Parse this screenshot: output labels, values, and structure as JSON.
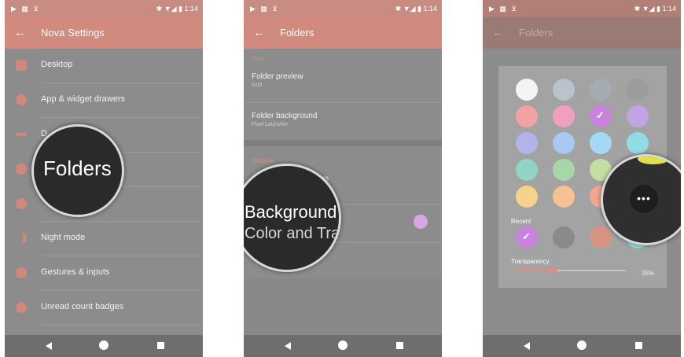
{
  "status": {
    "left_icons": "▶ ▦ ⊻",
    "right_text": "✱ ▼◢ ▮ 1:14"
  },
  "nav_icons": [
    "back-triangle",
    "home-circle",
    "recents-square"
  ],
  "screen1": {
    "title": "Nova Settings",
    "items": [
      {
        "label": "Desktop"
      },
      {
        "label": "App & widget drawers"
      },
      {
        "label": "D"
      },
      {
        "label": ""
      },
      {
        "label": ""
      },
      {
        "label": "Night mode"
      },
      {
        "label": "Gestures & inputs"
      },
      {
        "label": "Unread count badges"
      }
    ],
    "magnifier_text": "Folders"
  },
  "screen2": {
    "title": "Folders",
    "section_icon": "Icon",
    "folder_preview": {
      "title": "Folder preview",
      "value": "Grid"
    },
    "folder_background": {
      "title": "Folder background",
      "value": "Pixel Launcher"
    },
    "section_window": "Window",
    "partial_text": "on",
    "magnifier_title": "Background",
    "magnifier_sub": "Color and Tra"
  },
  "screen3": {
    "title": "Folders",
    "recent_label": "Recent",
    "transparency_label": "Transparency",
    "transparency_value": "35%",
    "transparency_fraction": 0.35,
    "swatch_colors": [
      "#f4f4f4",
      "#b9c3cc",
      "#a5acb3",
      "#9c9c9c",
      "#f2a2a2",
      "#f19fc0",
      "#c983de",
      "#c2a4e4",
      "#b3b3ea",
      "#a7c8f0",
      "#a5d8f2",
      "#8fdce4",
      "#8fd4c4",
      "#a9d6a6",
      "#c2dea2",
      "#e2e28a",
      "#f5d38d",
      "#f6c193",
      "#f3a692",
      "#e19388"
    ],
    "recent_colors": [
      "#c983de",
      "#8a8a8a",
      "#d79483",
      "#8fdce4"
    ]
  }
}
